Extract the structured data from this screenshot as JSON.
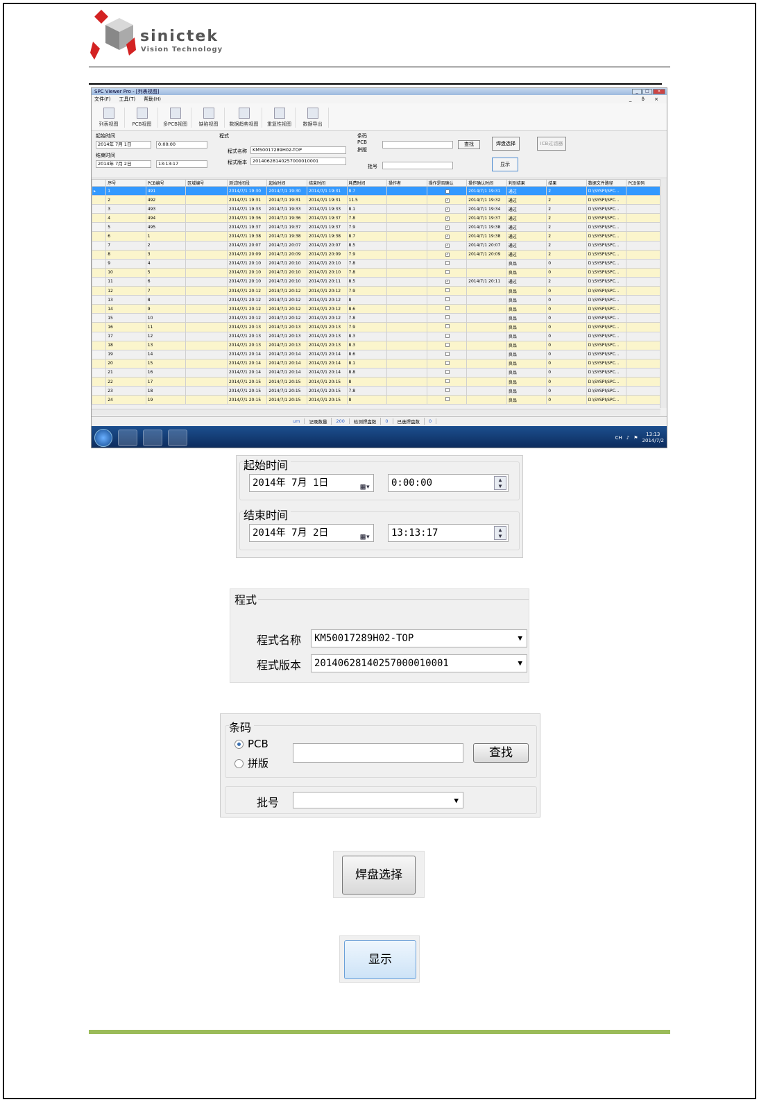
{
  "logo": {
    "name": "sinictek",
    "tagline": "Vision Technology"
  },
  "app": {
    "title": "SPC Viewer Pro - [列表视图]",
    "menu": [
      "文件(F)",
      "工具(T)",
      "帮助(H)"
    ],
    "menu_right": "_ ð ×",
    "toolbar": [
      "列表视图",
      "PCB视图",
      "多PCB视图",
      "缺陷视图",
      "数据趋势视图",
      "重复性视图",
      "数据导出"
    ],
    "filters": {
      "start_label": "起始时间",
      "start_date": "2014年 7月 1日",
      "start_time": "0:00:00",
      "end_label": "结束时间",
      "end_date": "2014年 7月 2日",
      "end_time": "13:13:17",
      "program_label": "程式",
      "program_name_label": "程式名称",
      "program_name": "KM50017289H02-TOP",
      "program_version_label": "程式版本",
      "program_version": "20140628140257000010001",
      "barcode_label": "条码",
      "pcb_radio": "PCB",
      "panel_radio": "拼版",
      "search_button": "查找",
      "batch_label": "批号",
      "pad_select_button": "焊盘选择",
      "filter_label": "ICB过滤器",
      "show_button": "显示"
    },
    "columns": [
      "序号",
      "PCB编号",
      "区域编号",
      "测试时间段",
      "起始时间",
      "结束时间",
      "耗费时间",
      "操作者",
      "操作是否确认",
      "操作确认时间",
      "判别结果",
      "结果",
      "数据文件路径",
      "PCB条码"
    ],
    "rows": [
      [
        "1",
        "491",
        "",
        "2014/7/1 19:30",
        "2014/7/1 19:30",
        "2014/7/1 19:31",
        "8.7",
        "",
        "y",
        "2014/7/1 19:31",
        "通过",
        "2",
        "D:\\SYSPI\\SPC..."
      ],
      [
        "2",
        "492",
        "",
        "2014/7/1 19:31",
        "2014/7/1 19:31",
        "2014/7/1 19:31",
        "11.5",
        "",
        "y",
        "2014/7/1 19:32",
        "通过",
        "2",
        "D:\\SYSPI\\SPC..."
      ],
      [
        "3",
        "493",
        "",
        "2014/7/1 19:33",
        "2014/7/1 19:33",
        "2014/7/1 19:33",
        "8.1",
        "",
        "y",
        "2014/7/1 19:34",
        "通过",
        "2",
        "D:\\SYSPI\\SPC..."
      ],
      [
        "4",
        "494",
        "",
        "2014/7/1 19:36",
        "2014/7/1 19:36",
        "2014/7/1 19:37",
        "7.8",
        "",
        "y",
        "2014/7/1 19:37",
        "通过",
        "2",
        "D:\\SYSPI\\SPC..."
      ],
      [
        "5",
        "495",
        "",
        "2014/7/1 19:37",
        "2014/7/1 19:37",
        "2014/7/1 19:37",
        "7.9",
        "",
        "y",
        "2014/7/1 19:38",
        "通过",
        "2",
        "D:\\SYSPI\\SPC..."
      ],
      [
        "6",
        "1",
        "",
        "2014/7/1 19:38",
        "2014/7/1 19:38",
        "2014/7/1 19:38",
        "8.7",
        "",
        "y",
        "2014/7/1 19:38",
        "通过",
        "2",
        "D:\\SYSPI\\SPC..."
      ],
      [
        "7",
        "2",
        "",
        "2014/7/1 20:07",
        "2014/7/1 20:07",
        "2014/7/1 20:07",
        "8.5",
        "",
        "y",
        "2014/7/1 20:07",
        "通过",
        "2",
        "D:\\SYSPI\\SPC..."
      ],
      [
        "8",
        "3",
        "",
        "2014/7/1 20:09",
        "2014/7/1 20:09",
        "2014/7/1 20:09",
        "7.9",
        "",
        "y",
        "2014/7/1 20:09",
        "通过",
        "2",
        "D:\\SYSPI\\SPC..."
      ],
      [
        "9",
        "4",
        "",
        "2014/7/1 20:10",
        "2014/7/1 20:10",
        "2014/7/1 20:10",
        "7.8",
        "",
        "n",
        "",
        "良品",
        "0",
        "D:\\SYSPI\\SPC..."
      ],
      [
        "10",
        "5",
        "",
        "2014/7/1 20:10",
        "2014/7/1 20:10",
        "2014/7/1 20:10",
        "7.8",
        "",
        "n",
        "",
        "良品",
        "0",
        "D:\\SYSPI\\SPC..."
      ],
      [
        "11",
        "6",
        "",
        "2014/7/1 20:10",
        "2014/7/1 20:10",
        "2014/7/1 20:11",
        "8.5",
        "",
        "y",
        "2014/7/1 20:11",
        "通过",
        "2",
        "D:\\SYSPI\\SPC..."
      ],
      [
        "12",
        "7",
        "",
        "2014/7/1 20:12",
        "2014/7/1 20:12",
        "2014/7/1 20:12",
        "7.9",
        "",
        "n",
        "",
        "良品",
        "0",
        "D:\\SYSPI\\SPC..."
      ],
      [
        "13",
        "8",
        "",
        "2014/7/1 20:12",
        "2014/7/1 20:12",
        "2014/7/1 20:12",
        "8",
        "",
        "n",
        "",
        "良品",
        "0",
        "D:\\SYSPI\\SPC..."
      ],
      [
        "14",
        "9",
        "",
        "2014/7/1 20:12",
        "2014/7/1 20:12",
        "2014/7/1 20:12",
        "8.6",
        "",
        "n",
        "",
        "良品",
        "0",
        "D:\\SYSPI\\SPC..."
      ],
      [
        "15",
        "10",
        "",
        "2014/7/1 20:12",
        "2014/7/1 20:12",
        "2014/7/1 20:12",
        "7.8",
        "",
        "n",
        "",
        "良品",
        "0",
        "D:\\SYSPI\\SPC..."
      ],
      [
        "16",
        "11",
        "",
        "2014/7/1 20:13",
        "2014/7/1 20:13",
        "2014/7/1 20:13",
        "7.9",
        "",
        "n",
        "",
        "良品",
        "0",
        "D:\\SYSPI\\SPC..."
      ],
      [
        "17",
        "12",
        "",
        "2014/7/1 20:13",
        "2014/7/1 20:13",
        "2014/7/1 20:13",
        "8.3",
        "",
        "n",
        "",
        "良品",
        "0",
        "D:\\SYSPI\\SPC..."
      ],
      [
        "18",
        "13",
        "",
        "2014/7/1 20:13",
        "2014/7/1 20:13",
        "2014/7/1 20:13",
        "8.3",
        "",
        "n",
        "",
        "良品",
        "0",
        "D:\\SYSPI\\SPC..."
      ],
      [
        "19",
        "14",
        "",
        "2014/7/1 20:14",
        "2014/7/1 20:14",
        "2014/7/1 20:14",
        "8.6",
        "",
        "n",
        "",
        "良品",
        "0",
        "D:\\SYSPI\\SPC..."
      ],
      [
        "20",
        "15",
        "",
        "2014/7/1 20:14",
        "2014/7/1 20:14",
        "2014/7/1 20:14",
        "8.1",
        "",
        "n",
        "",
        "良品",
        "0",
        "D:\\SYSPI\\SPC..."
      ],
      [
        "21",
        "16",
        "",
        "2014/7/1 20:14",
        "2014/7/1 20:14",
        "2014/7/1 20:14",
        "8.8",
        "",
        "n",
        "",
        "良品",
        "0",
        "D:\\SYSPI\\SPC..."
      ],
      [
        "22",
        "17",
        "",
        "2014/7/1 20:15",
        "2014/7/1 20:15",
        "2014/7/1 20:15",
        "8",
        "",
        "n",
        "",
        "良品",
        "0",
        "D:\\SYSPI\\SPC..."
      ],
      [
        "23",
        "18",
        "",
        "2014/7/1 20:15",
        "2014/7/1 20:15",
        "2014/7/1 20:15",
        "7.8",
        "",
        "n",
        "",
        "良品",
        "0",
        "D:\\SYSPI\\SPC..."
      ],
      [
        "24",
        "19",
        "",
        "2014/7/1 20:15",
        "2014/7/1 20:15",
        "2014/7/1 20:15",
        "8",
        "",
        "n",
        "",
        "良品",
        "0",
        "D:\\SYSPI\\SPC..."
      ]
    ],
    "status": {
      "unit": "um",
      "record_label": "记录数量",
      "record_count": "200",
      "detected_label": "检测焊盘数",
      "detected_count": "0",
      "selected_label": "已选焊盘数",
      "selected_count": "0"
    },
    "tray": {
      "lang": "CH",
      "time": "13:13",
      "date": "2014/7/2"
    }
  }
}
